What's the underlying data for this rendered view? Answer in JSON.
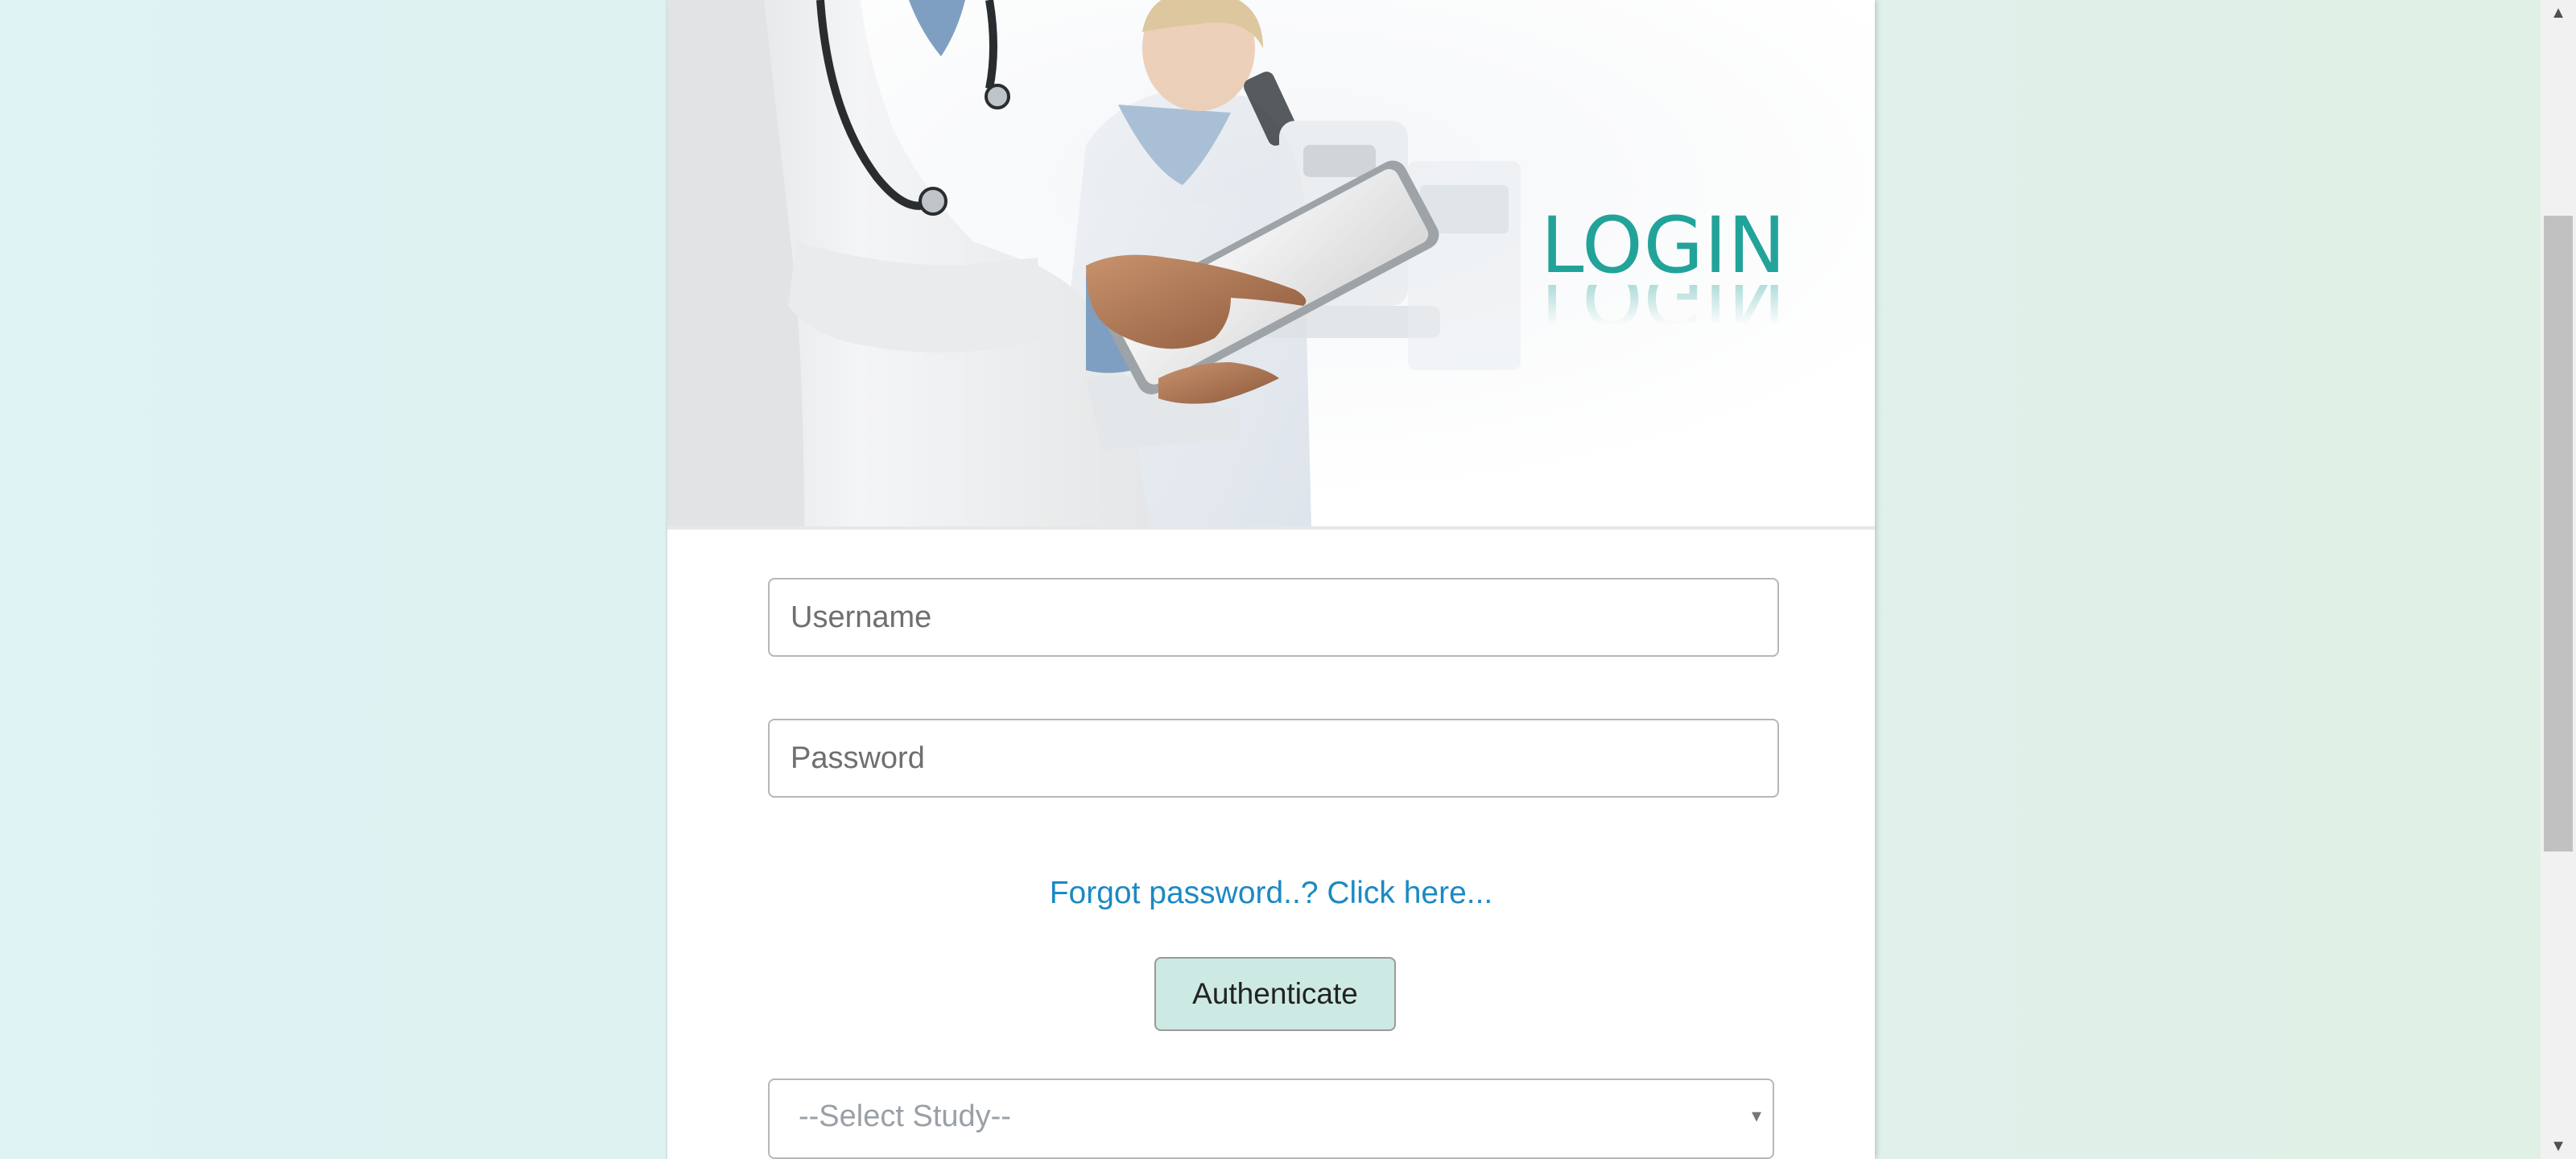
{
  "banner": {
    "image_icon": "doctor-with-tablet-photo",
    "title": "LOGIN",
    "title_color": "#22a39a"
  },
  "form": {
    "username_placeholder": "Username",
    "password_placeholder": "Password",
    "forgot_link": "Forgot password..? Click here...",
    "authenticate_label": "Authenticate",
    "select_study_value": "--Select Study--",
    "select_caret_icon": "▾"
  },
  "colors": {
    "link": "#1c89c4",
    "button_bg": "#cde9e3",
    "accent": "#22a39a"
  },
  "scrollbar": {
    "up_icon": "▲",
    "down_icon": "▼"
  }
}
